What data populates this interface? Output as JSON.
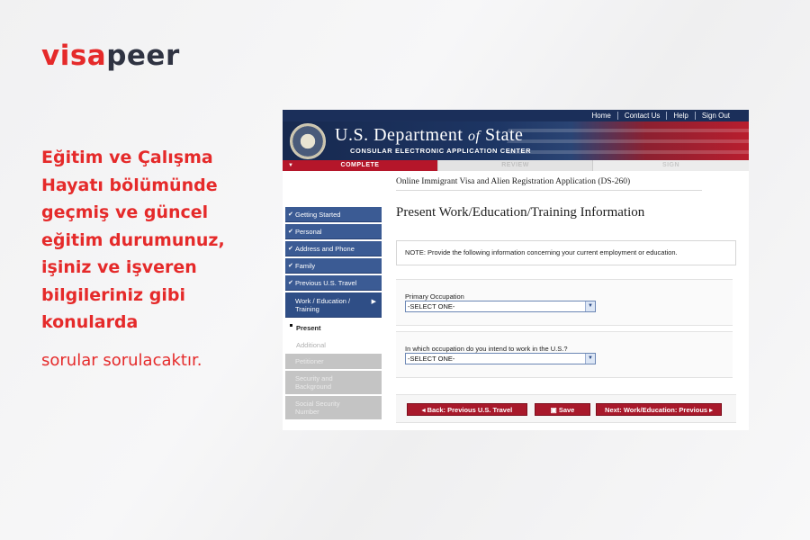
{
  "logo": {
    "part1": "visa",
    "part2": "peer"
  },
  "headline": "Eğitim ve Çalışma Hayatı bölümünde geçmiş ve güncel eğitim durumunuz, işiniz ve işveren bilgileriniz gibi konularda",
  "subtext": "sorular sorulacaktır.",
  "colors": {
    "accent": "#e52a2a",
    "navy": "#1b2f5a",
    "sidebar": "#3b5b94",
    "button": "#a8192b"
  },
  "screenshot": {
    "topnav": [
      "Home",
      "Contact Us",
      "Help",
      "Sign Out"
    ],
    "banner": {
      "dept_prefix": "U.S. Department ",
      "dept_of": "of",
      "dept_suffix": " State",
      "subtitle": "CONSULAR ELECTRONIC APPLICATION CENTER"
    },
    "steps": {
      "complete": "COMPLETE",
      "review": "REVIEW",
      "sign": "SIGN"
    },
    "app_name": "Online Immigrant Visa and Alien Registration Application (DS-260)",
    "sidebar": {
      "getting_started": "Getting Started",
      "personal": "Personal",
      "address_phone": "Address and Phone",
      "family": "Family",
      "previous_travel": "Previous U.S. Travel",
      "current": "Work / Education / Training",
      "present": "Present",
      "additional": "Additional",
      "petitioner": "Petitioner",
      "security": "Security and Background",
      "social_security": "Social Security Number"
    },
    "title": "Present Work/Education/Training Information",
    "note": "NOTE: Provide the following information concerning your current employment or education.",
    "field1": {
      "label": "Primary Occupation",
      "value": "-SELECT ONE-"
    },
    "field2": {
      "label": "In which occupation do you intend to work in the U.S.?",
      "value": "-SELECT ONE-"
    },
    "buttons": {
      "back": "Back: Previous U.S. Travel",
      "save": "Save",
      "next": "Next: Work/Education: Previous"
    }
  }
}
